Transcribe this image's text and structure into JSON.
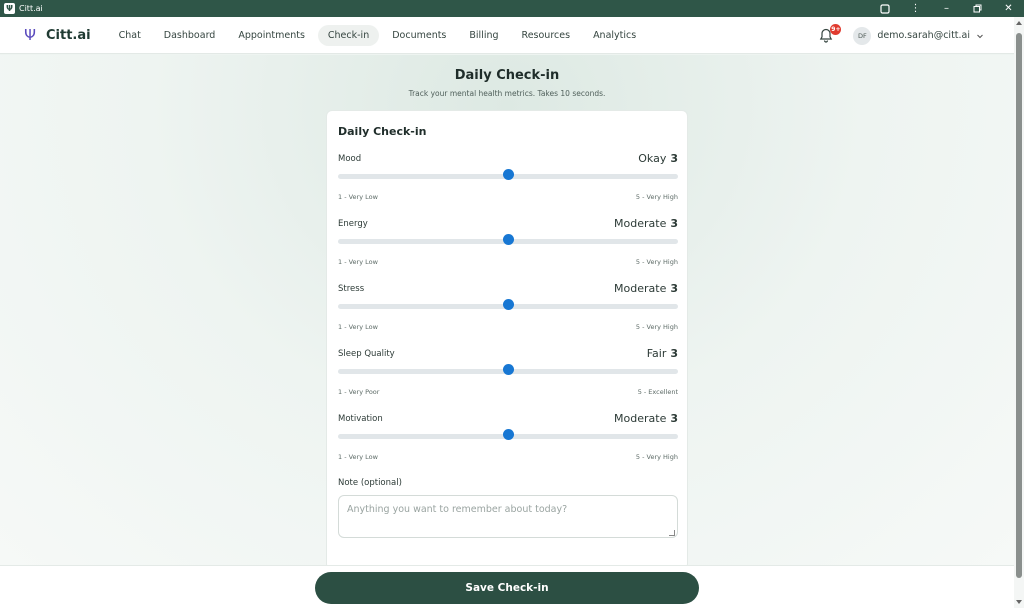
{
  "window": {
    "title": "Citt.ai",
    "logo_glyph": "Ψ"
  },
  "navbar": {
    "brand": "Citt.ai",
    "items": [
      {
        "label": "Chat",
        "active": false
      },
      {
        "label": "Dashboard",
        "active": false
      },
      {
        "label": "Appointments",
        "active": false
      },
      {
        "label": "Check-in",
        "active": true
      },
      {
        "label": "Documents",
        "active": false
      },
      {
        "label": "Billing",
        "active": false
      },
      {
        "label": "Resources",
        "active": false
      },
      {
        "label": "Analytics",
        "active": false
      }
    ],
    "notification_count": "9+",
    "avatar_initials": "DF",
    "user_email": "demo.sarah@citt.ai"
  },
  "page": {
    "title": "Daily Check-in",
    "subtitle": "Track your mental health metrics. Takes 10 seconds."
  },
  "card": {
    "title": "Daily Check-in",
    "metrics": [
      {
        "label": "Mood",
        "value_text": "Okay",
        "value": "3",
        "min_label": "1 - Very Low",
        "max_label": "5 - Very High",
        "level": 0.5
      },
      {
        "label": "Energy",
        "value_text": "Moderate",
        "value": "3",
        "min_label": "1 - Very Low",
        "max_label": "5 - Very High",
        "level": 0.5
      },
      {
        "label": "Stress",
        "value_text": "Moderate",
        "value": "3",
        "min_label": "1 - Very Low",
        "max_label": "5 - Very High",
        "level": 0.5
      },
      {
        "label": "Sleep Quality",
        "value_text": "Fair",
        "value": "3",
        "min_label": "1 - Very Poor",
        "max_label": "5 - Excellent",
        "level": 0.5
      },
      {
        "label": "Motivation",
        "value_text": "Moderate",
        "value": "3",
        "min_label": "1 - Very Low",
        "max_label": "5 - Very High",
        "level": 0.5
      }
    ],
    "note_label": "Note (optional)",
    "note_placeholder": "Anything you want to remember about today?",
    "note_value": ""
  },
  "footer": {
    "save_label": "Save Check-in"
  },
  "colors": {
    "primary": "#2c4f43",
    "slider": "#1777d3",
    "badge": "#e03b2f"
  }
}
